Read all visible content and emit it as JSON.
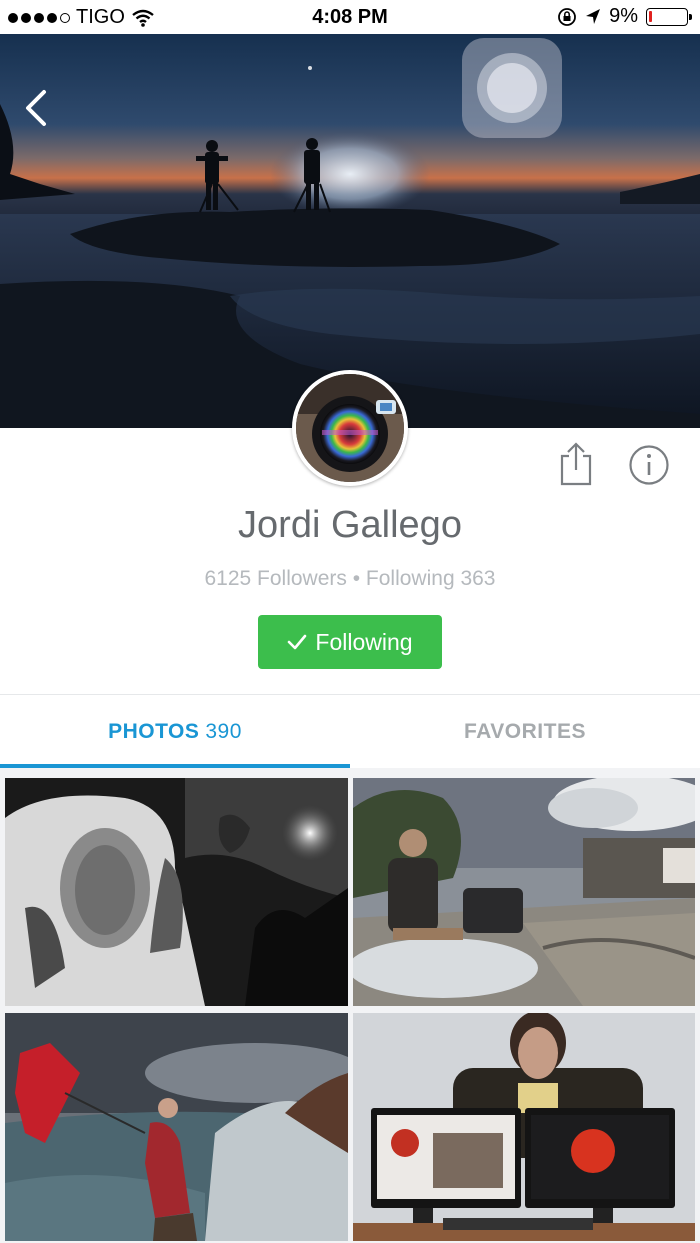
{
  "status_bar": {
    "carrier": "TIGO",
    "time": "4:08 PM",
    "battery_percent": "9%",
    "battery_level": 0.09,
    "battery_color": "#e0211e"
  },
  "cover": {
    "back_icon": "chevron-left-icon"
  },
  "profile": {
    "name": "Jordi Gallego",
    "stats": "6125 Followers • Following 363",
    "follow_label": "Following",
    "follow_color": "#3cbe4c",
    "share_icon": "share-icon",
    "info_icon": "info-icon"
  },
  "tabs": {
    "photos_label": "PHOTOS",
    "photos_count": "390",
    "favorites_label": "FAVORITES",
    "active_color": "#1a96d4"
  },
  "photos": [
    {
      "subject": "elderly woman in headscarf, black and white"
    },
    {
      "subject": "woman riding miniature steam train"
    },
    {
      "subject": "woman with red umbrella at stormy sea"
    },
    {
      "subject": "woman with two monitors"
    }
  ]
}
